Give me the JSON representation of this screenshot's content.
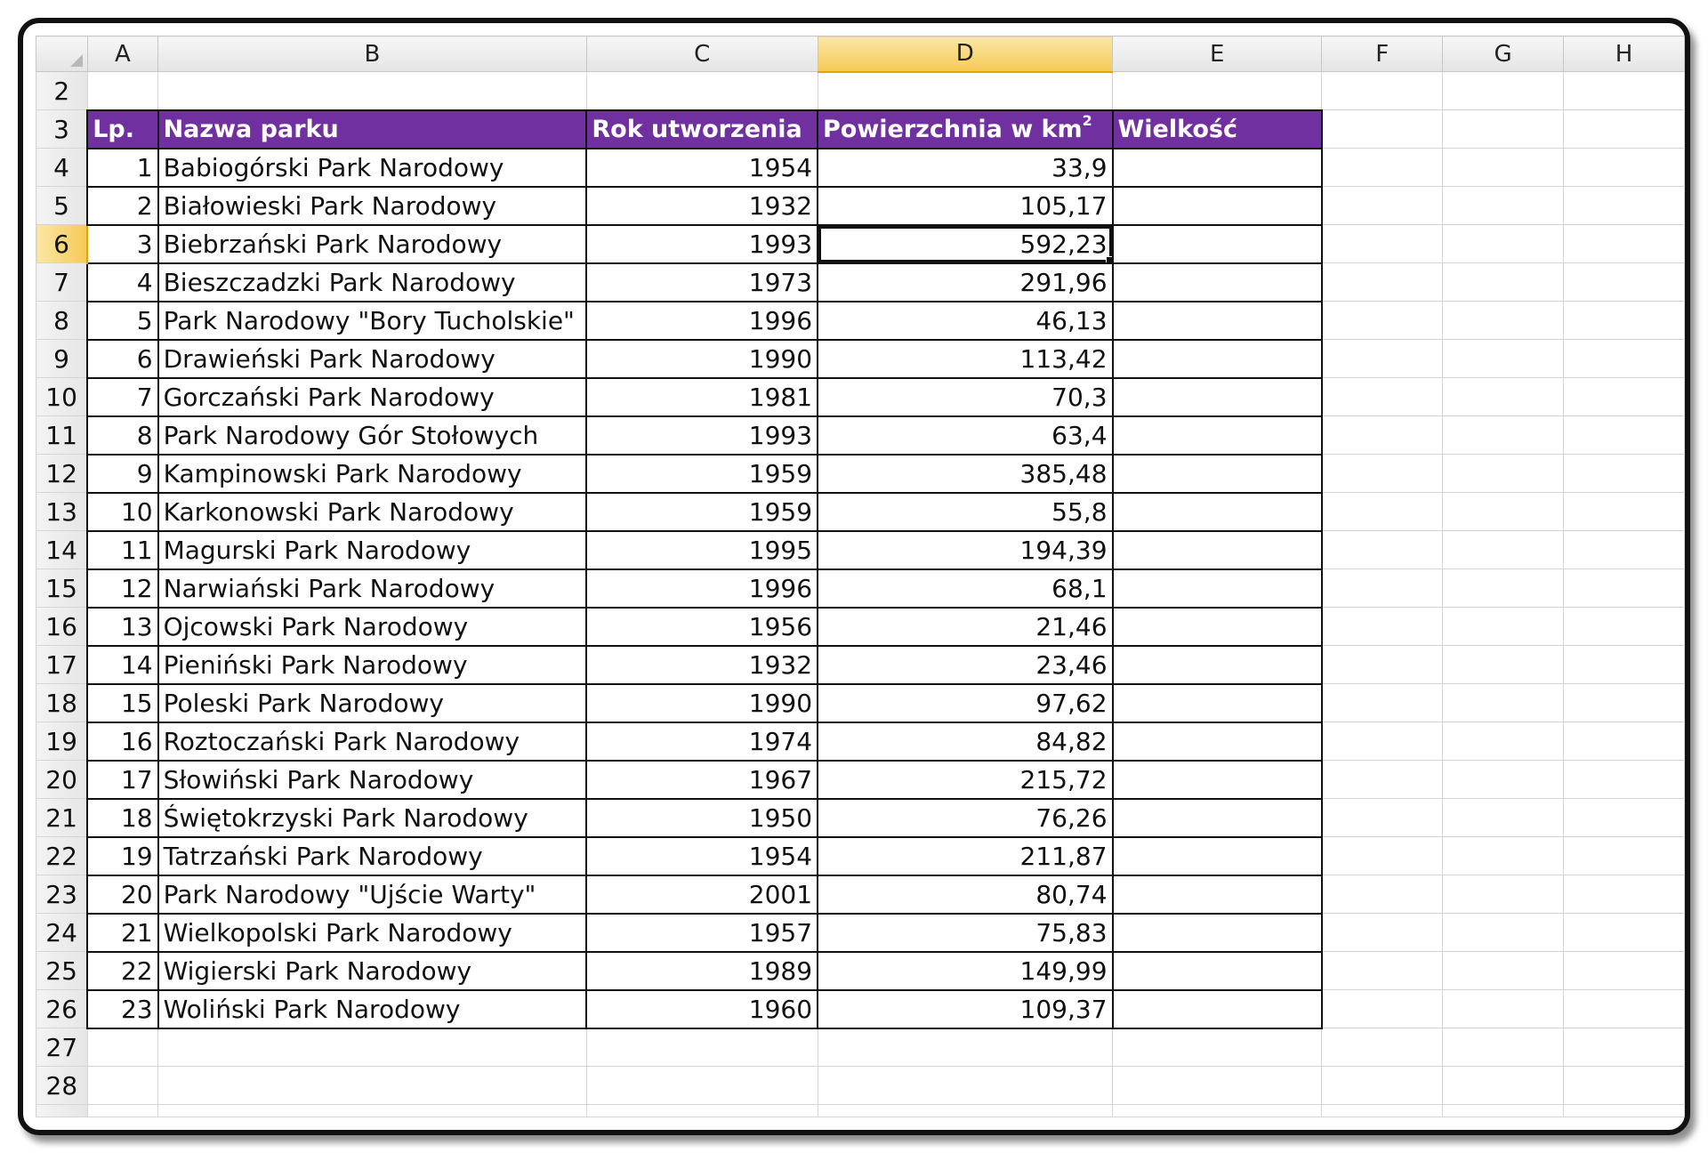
{
  "columns": [
    "A",
    "B",
    "C",
    "D",
    "E",
    "F",
    "G",
    "H"
  ],
  "selected_cell": "D6",
  "header_row": {
    "row_number": "3",
    "lp": "Lp.",
    "name": "Nazwa parku",
    "year": "Rok utworzenia",
    "area": "Powierzchnia w km",
    "area_sup": "2",
    "size": "Wielkość"
  },
  "empty_rows_top": [
    "2"
  ],
  "rows": [
    {
      "row": "4",
      "lp": "1",
      "name": "Babiogórski Park Narodowy",
      "year": "1954",
      "area": "33,9"
    },
    {
      "row": "5",
      "lp": "2",
      "name": "Białowieski Park Narodowy",
      "year": "1932",
      "area": "105,17"
    },
    {
      "row": "6",
      "lp": "3",
      "name": "Biebrzański Park Narodowy",
      "year": "1993",
      "area": "592,23"
    },
    {
      "row": "7",
      "lp": "4",
      "name": "Bieszczadzki Park Narodowy",
      "year": "1973",
      "area": "291,96"
    },
    {
      "row": "8",
      "lp": "5",
      "name": "Park Narodowy \"Bory Tucholskie\"",
      "year": "1996",
      "area": "46,13"
    },
    {
      "row": "9",
      "lp": "6",
      "name": "Drawieński Park Narodowy",
      "year": "1990",
      "area": "113,42"
    },
    {
      "row": "10",
      "lp": "7",
      "name": "Gorczański Park Narodowy",
      "year": "1981",
      "area": "70,3"
    },
    {
      "row": "11",
      "lp": "8",
      "name": "Park Narodowy Gór Stołowych",
      "year": "1993",
      "area": "63,4"
    },
    {
      "row": "12",
      "lp": "9",
      "name": "Kampinowski Park Narodowy",
      "year": "1959",
      "area": "385,48"
    },
    {
      "row": "13",
      "lp": "10",
      "name": "Karkonowski Park Narodowy",
      "year": "1959",
      "area": "55,8"
    },
    {
      "row": "14",
      "lp": "11",
      "name": "Magurski Park Narodowy",
      "year": "1995",
      "area": "194,39"
    },
    {
      "row": "15",
      "lp": "12",
      "name": "Narwiański Park Narodowy",
      "year": "1996",
      "area": "68,1"
    },
    {
      "row": "16",
      "lp": "13",
      "name": "Ojcowski Park Narodowy",
      "year": "1956",
      "area": "21,46"
    },
    {
      "row": "17",
      "lp": "14",
      "name": "Pieniński Park Narodowy",
      "year": "1932",
      "area": "23,46"
    },
    {
      "row": "18",
      "lp": "15",
      "name": "Poleski Park Narodowy",
      "year": "1990",
      "area": "97,62"
    },
    {
      "row": "19",
      "lp": "16",
      "name": "Roztoczański Park Narodowy",
      "year": "1974",
      "area": "84,82"
    },
    {
      "row": "20",
      "lp": "17",
      "name": "Słowiński Park Narodowy",
      "year": "1967",
      "area": "215,72"
    },
    {
      "row": "21",
      "lp": "18",
      "name": "Świętokrzyski Park Narodowy",
      "year": "1950",
      "area": "76,26"
    },
    {
      "row": "22",
      "lp": "19",
      "name": "Tatrzański Park Narodowy",
      "year": "1954",
      "area": "211,87"
    },
    {
      "row": "23",
      "lp": "20",
      "name": "Park Narodowy \"Ujście Warty\"",
      "year": "2001",
      "area": "80,74"
    },
    {
      "row": "24",
      "lp": "21",
      "name": "Wielkopolski Park Narodowy",
      "year": "1957",
      "area": "75,83"
    },
    {
      "row": "25",
      "lp": "22",
      "name": "Wigierski Park Narodowy",
      "year": "1989",
      "area": "149,99"
    },
    {
      "row": "26",
      "lp": "23",
      "name": "Woliński Park Narodowy",
      "year": "1960",
      "area": "109,37"
    }
  ],
  "empty_rows_bottom": [
    "27",
    "28"
  ],
  "colors": {
    "header_fill": "#7030a0",
    "header_text": "#ffffff",
    "selection_highlight": "#f6c955",
    "gridline": "#d4d4d4"
  }
}
